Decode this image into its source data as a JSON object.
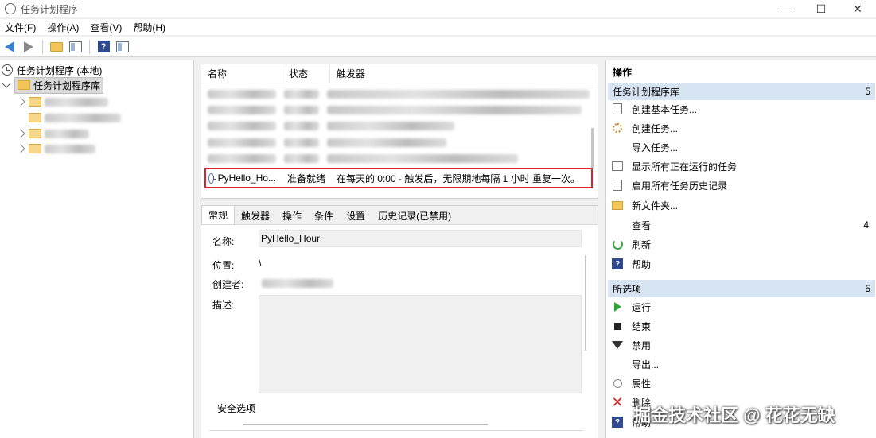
{
  "window": {
    "title": "任务计划程序",
    "controls": {
      "minimize": "—",
      "maximize": "☐",
      "close": "✕"
    }
  },
  "menu": [
    "文件(F)",
    "操作(A)",
    "查看(V)",
    "帮助(H)"
  ],
  "tree": {
    "root_label": "任务计划程序 (本地)",
    "library_label": "任务计划程序库"
  },
  "task_list": {
    "columns": [
      "名称",
      "状态",
      "触发器"
    ],
    "highlighted_task": {
      "name": "PyHello_Ho...",
      "status": "准备就绪",
      "trigger": "在每天的 0:00 - 触发后，无限期地每隔 1 小时 重复一次。"
    }
  },
  "details": {
    "tabs": [
      "常规",
      "触发器",
      "操作",
      "条件",
      "设置",
      "历史记录(已禁用)"
    ],
    "general": {
      "name_label": "名称:",
      "name_value": "PyHello_Hour",
      "location_label": "位置:",
      "location_value": "\\",
      "author_label": "创建者:",
      "description_label": "描述:",
      "security_label": "安全选项"
    }
  },
  "actions": {
    "title": "操作",
    "section1": {
      "header": "任务计划程序库",
      "count": "5",
      "items": [
        {
          "label": "创建基本任务...",
          "icon": "create-basic-task-icon"
        },
        {
          "label": "创建任务...",
          "icon": "create-task-icon"
        },
        {
          "label": "导入任务...",
          "icon": ""
        },
        {
          "label": "显示所有正在运行的任务",
          "icon": "running-tasks-icon"
        },
        {
          "label": "启用所有任务历史记录",
          "icon": "history-icon"
        },
        {
          "label": "新文件夹...",
          "icon": "new-folder-icon"
        },
        {
          "label": "查看",
          "icon": "",
          "count": "4"
        },
        {
          "label": "刷新",
          "icon": "refresh-icon"
        },
        {
          "label": "帮助",
          "icon": "help-icon"
        }
      ]
    },
    "section2": {
      "header": "所选项",
      "count": "5",
      "items": [
        {
          "label": "运行",
          "icon": "run-icon"
        },
        {
          "label": "结束",
          "icon": "end-icon"
        },
        {
          "label": "禁用",
          "icon": "disable-icon"
        },
        {
          "label": "导出...",
          "icon": ""
        },
        {
          "label": "属性",
          "icon": "properties-icon"
        },
        {
          "label": "删除",
          "icon": "delete-icon"
        },
        {
          "label": "帮助",
          "icon": "help-icon"
        }
      ]
    }
  },
  "watermark": "掘金技术社区 @ 花花无缺"
}
